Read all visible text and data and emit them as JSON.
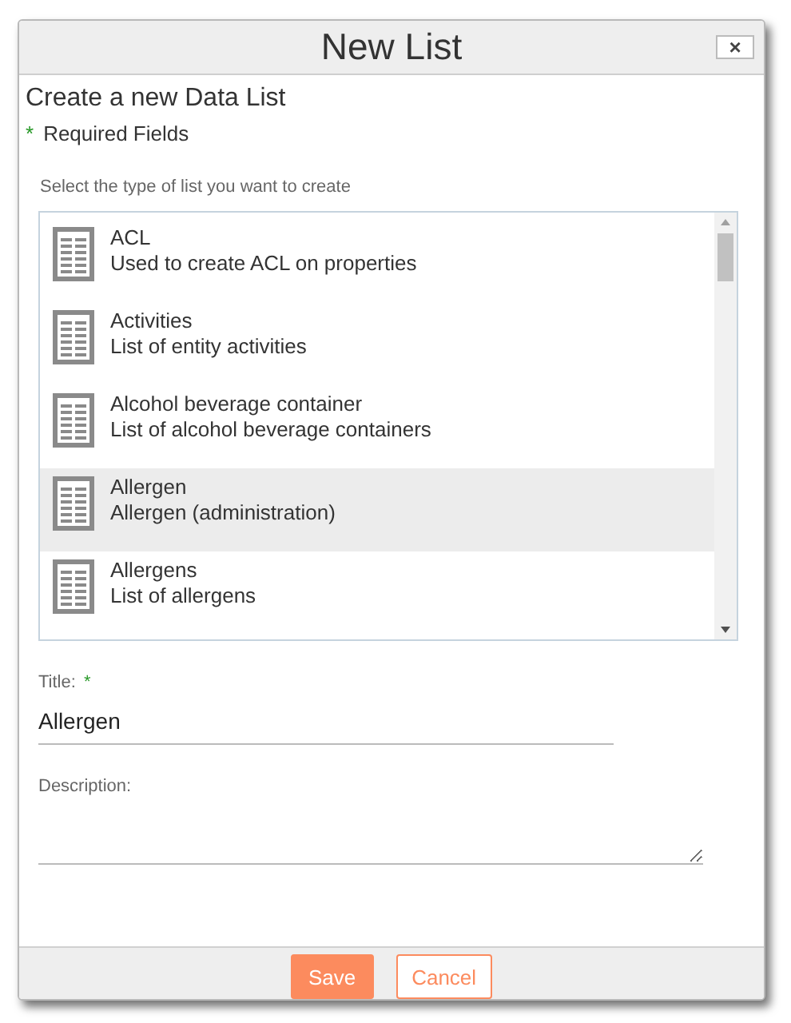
{
  "dialog": {
    "title": "New List",
    "close": "×"
  },
  "heading": "Create a new Data List",
  "required": {
    "mark": "*",
    "text": "Required Fields"
  },
  "list_prompt": "Select the type of list you want to create",
  "list_types": [
    {
      "name": "ACL",
      "description": "Used to create ACL on properties",
      "selected": false
    },
    {
      "name": "Activities",
      "description": "List of entity activities",
      "selected": false
    },
    {
      "name": "Alcohol beverage container",
      "description": "List of alcohol beverage containers",
      "selected": false
    },
    {
      "name": "Allergen",
      "description": "Allergen (administration)",
      "selected": true
    },
    {
      "name": "Allergens",
      "description": "List of allergens",
      "selected": false
    }
  ],
  "fields": [
    {
      "kind": "input",
      "label": "Title:",
      "required_mark": "*",
      "value": "Allergen"
    },
    {
      "kind": "textarea",
      "label": "Description:"
    }
  ],
  "buttons": [
    {
      "kind": "primary",
      "label": "Save"
    },
    {
      "kind": "secondary",
      "label": "Cancel"
    }
  ]
}
